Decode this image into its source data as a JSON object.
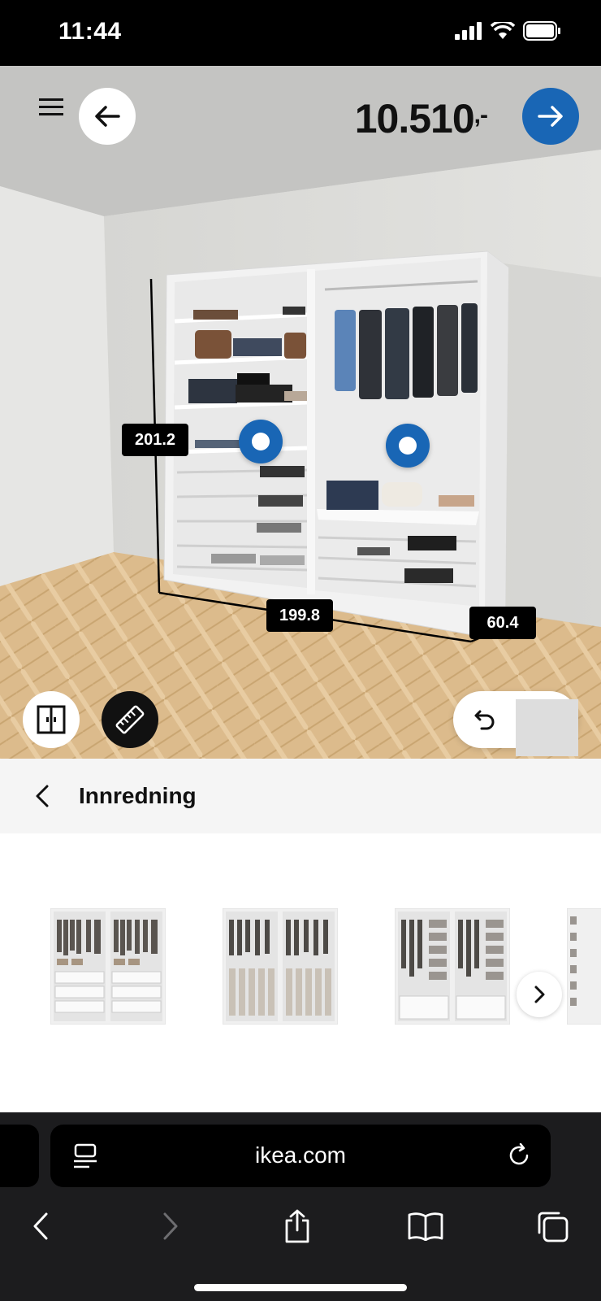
{
  "status_bar": {
    "time": "11:44"
  },
  "header": {
    "price": "10.510",
    "price_suffix": ",-"
  },
  "scene": {
    "dimensions": {
      "height": "201.2",
      "width": "199.8",
      "depth": "60.4"
    },
    "colors": {
      "accent": "#1966b5",
      "wall": "#dcdcda",
      "floor": "#d9b88a"
    }
  },
  "section": {
    "title": "Innredning"
  },
  "browser": {
    "url": "ikea.com"
  },
  "icons": {
    "menu": "hamburger-menu-icon",
    "back": "arrow-left-icon",
    "next": "arrow-right-icon",
    "door": "wardrobe-doors-icon",
    "measure": "ruler-icon",
    "undo": "undo-icon",
    "redo": "redo-icon"
  }
}
